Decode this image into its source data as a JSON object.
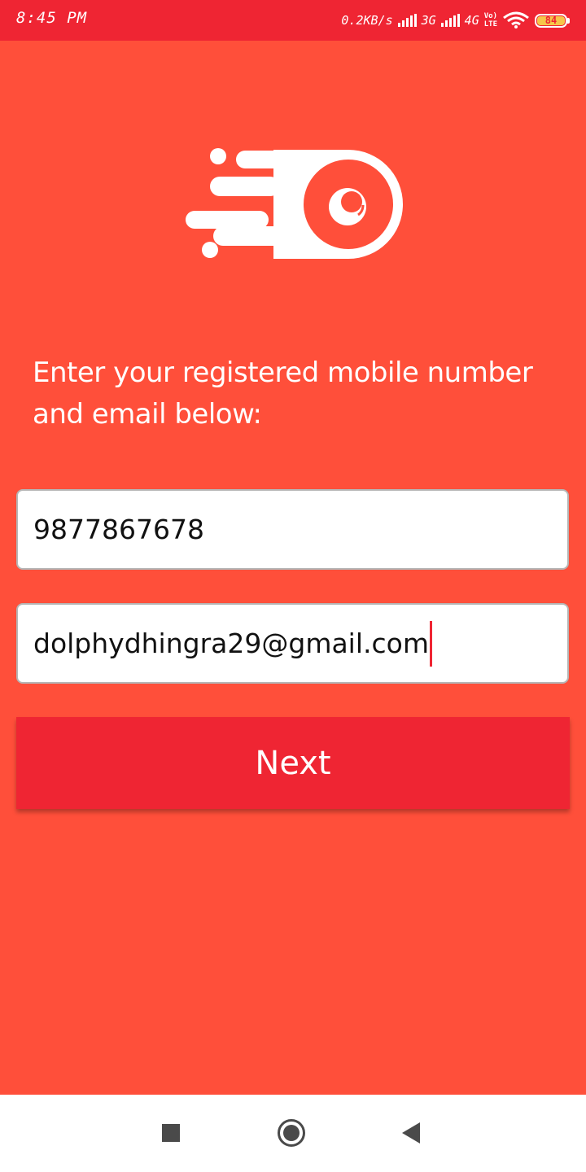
{
  "status_bar": {
    "time": "8:45 PM",
    "network_speed": "0.2KB/s",
    "network_1": "3G",
    "network_2": "4G",
    "volte_top": "Vo)",
    "volte_bottom": "LTE",
    "battery": "84",
    "icons": [
      "signal-icon",
      "wifi-icon",
      "battery-icon"
    ]
  },
  "colors": {
    "background": "#ff4f3a",
    "accent": "#ef2533",
    "field_background": "#ffffff",
    "text_light": "#ffffff"
  },
  "logo": {
    "icon": "speeding-ball-logo"
  },
  "form": {
    "prompt": "Enter your registered mobile number and email below:",
    "phone_value": "9877867678",
    "email_value": "dolphydhingra29@gmail.com",
    "next_label": "Next"
  },
  "nav_bar": {
    "icons": [
      "recent-apps-icon",
      "home-icon",
      "back-icon"
    ]
  }
}
